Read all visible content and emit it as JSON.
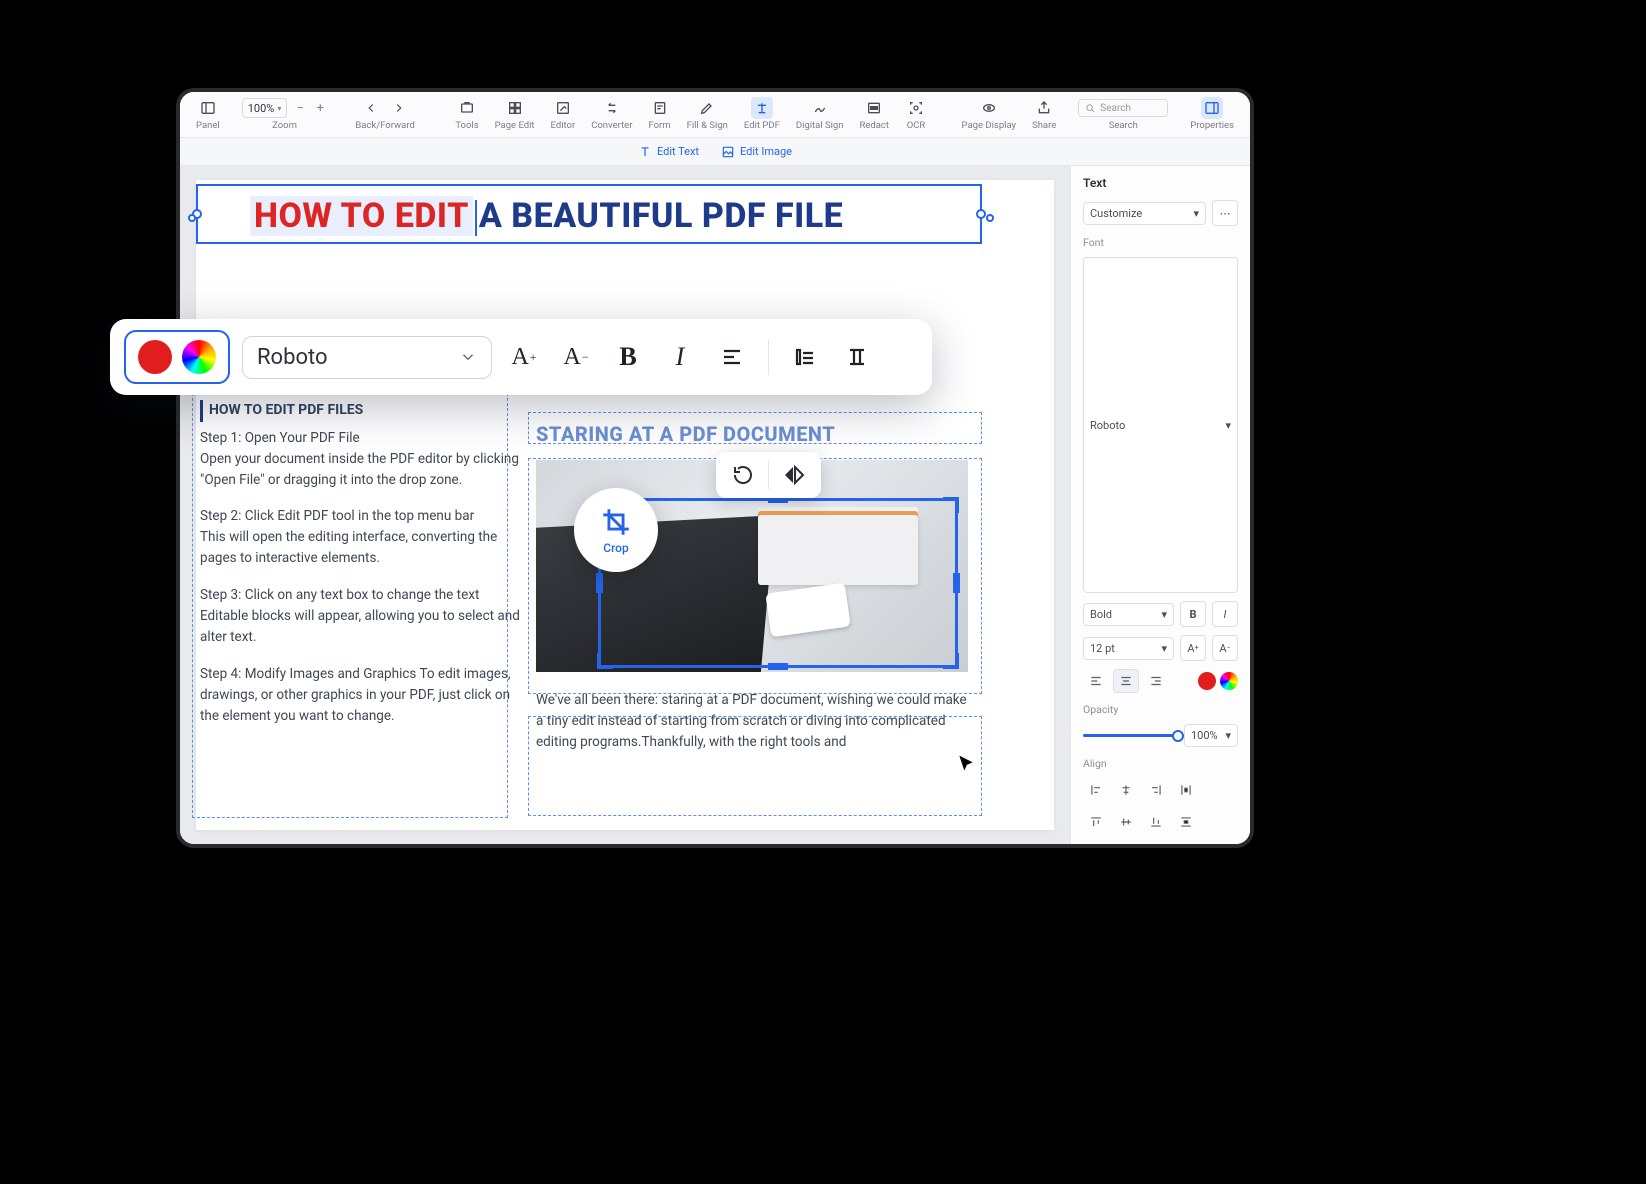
{
  "toolbar": {
    "panel": "Panel",
    "zoom_label": "Zoom",
    "zoom_value": "100%",
    "backfwd": "Back/Forward",
    "tools": "Tools",
    "page_edit": "Page Edit",
    "editor": "Editor",
    "converter": "Converter",
    "form": "Form",
    "fill_sign": "Fill & Sign",
    "edit_pdf": "Edit PDF",
    "digital_sign": "Digital Sign",
    "redact": "Redact",
    "ocr": "OCR",
    "page_display": "Page Display",
    "share": "Share",
    "search": "Search",
    "search_placeholder": "Search",
    "properties": "Properties"
  },
  "subbar": {
    "edit_text": "Edit Text",
    "edit_image": "Edit Image"
  },
  "document": {
    "title_red": "HOW TO EDIT",
    "title_blue": "A BEAUTIFUL PDF FILE",
    "left_heading": "HOW TO EDIT PDF FILES",
    "step1_title": "Step 1: Open Your PDF File",
    "step1_body": "Open your document inside the PDF editor by clicking \"Open File\" or dragging it into the drop zone.",
    "step2_title": "Step 2: Click Edit PDF tool in the top menu bar",
    "step2_body": "This will open the editing interface, converting the pages to interactive elements.",
    "step3_title": "Step 3: Click on any text box to change the text",
    "step3_body": "Editable blocks will appear, allowing you to select and alter text.",
    "step4": "Step 4: Modify Images and Graphics To edit images, drawings, or other graphics in your PDF, just click on the element you want to change.",
    "right_heading": "STARING AT A PDF DOCUMENT",
    "right_para": "We've all been there: staring at a PDF document, wishing we could make a tiny edit instead of starting from scratch or diving into complicated editing programs.Thankfully, with the right tools and"
  },
  "float": {
    "font": "Roboto"
  },
  "crop": {
    "label": "Crop"
  },
  "props": {
    "section": "Text",
    "customize": "Customize",
    "font_label": "Font",
    "font_family": "Roboto",
    "font_weight": "Bold",
    "font_size": "12 pt",
    "opacity_label": "Opacity",
    "opacity_value": "100%",
    "align_label": "Align",
    "colors": {
      "current": "#e11d1d"
    }
  }
}
